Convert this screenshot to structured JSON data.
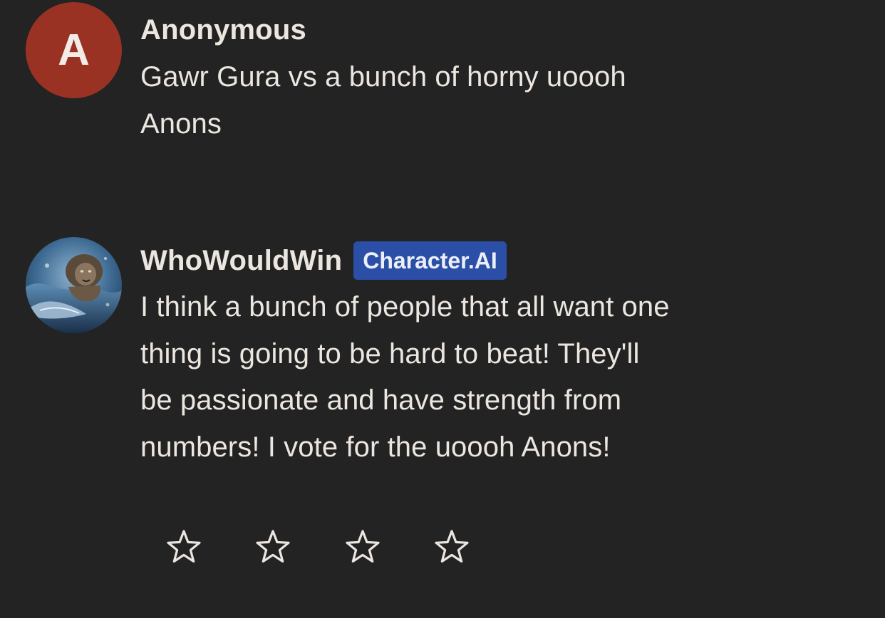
{
  "messages": [
    {
      "author": "Anonymous",
      "avatar_letter": "A",
      "avatar_color": "#9A3224",
      "lines": [
        "Gawr Gura vs a bunch of horny uoooh",
        "Anons"
      ]
    },
    {
      "author": "WhoWouldWin",
      "badge": "Character.AI",
      "badge_color": "#2B4FA6",
      "avatar_icon": "lion-whale-avatar-icon",
      "lines": [
        "I think a bunch of people that all want one",
        "thing is going to be hard to beat! They'll",
        "be passionate and have strength from",
        "numbers! I vote for the uoooh Anons!"
      ]
    }
  ],
  "rating": {
    "stars_count": 4,
    "icon": "star-outline-icon",
    "selected": 0
  },
  "colors": {
    "background": "#232323",
    "text": "#ECE6E0"
  }
}
